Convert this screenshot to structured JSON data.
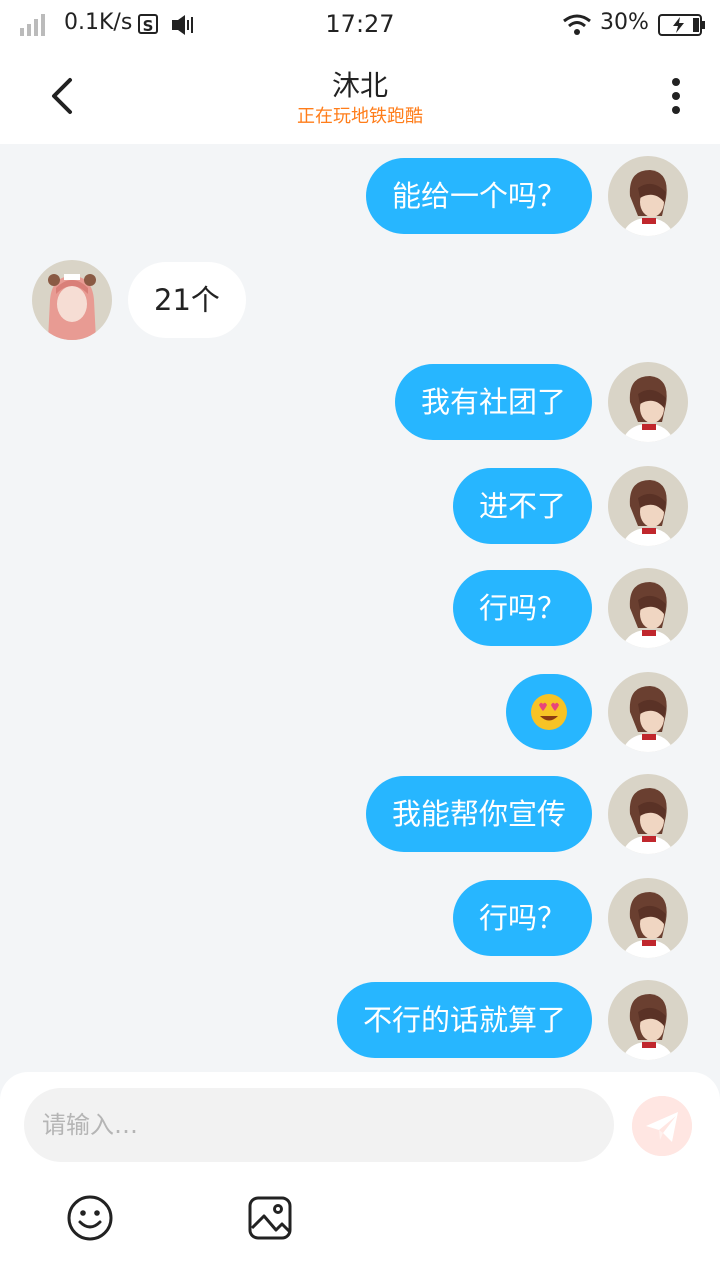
{
  "status_bar": {
    "net_speed": "0.1K/s",
    "s_badge": "S",
    "time": "17:27",
    "battery_percent": "30%"
  },
  "header": {
    "title": "沐北",
    "subtitle": "正在玩地铁跑酷",
    "back_icon": "chevron-left-icon",
    "more_icon": "more-vertical-icon"
  },
  "colors": {
    "accent_bubble": "#27b6ff",
    "subtitle_orange": "#ff7d1a",
    "background": "#f3f5f7"
  },
  "messages": [
    {
      "sender": "me",
      "text": "能给一个吗？"
    },
    {
      "sender": "other",
      "text": "21个"
    },
    {
      "sender": "me",
      "text": "我有社团了"
    },
    {
      "sender": "me",
      "text": "进不了"
    },
    {
      "sender": "me",
      "text": "行吗？"
    },
    {
      "sender": "me",
      "type": "emoji",
      "text": "😍"
    },
    {
      "sender": "me",
      "text": "我能帮你宣传"
    },
    {
      "sender": "me",
      "text": "行吗？"
    },
    {
      "sender": "me",
      "text": "不行的话就算了"
    }
  ],
  "composer": {
    "placeholder": "请输入…",
    "value": "",
    "send_icon": "paper-plane-icon",
    "emoji_icon": "smiley-icon",
    "image_icon": "image-icon"
  }
}
